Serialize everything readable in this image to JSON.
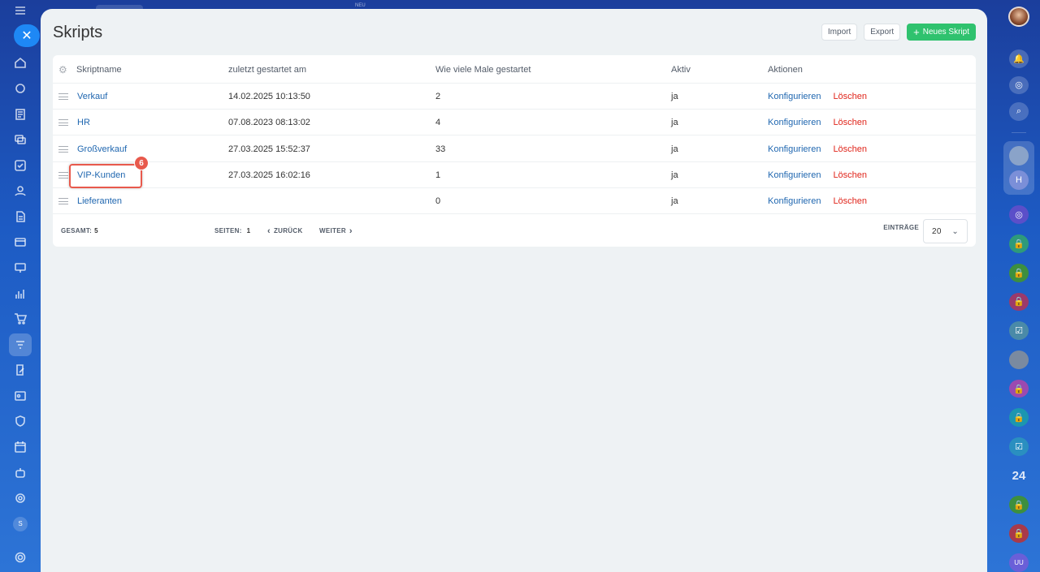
{
  "topbar": {
    "neu_label": "NEU"
  },
  "sidebar": {
    "user_initial": "S"
  },
  "right_rail": {
    "counter_label": "24",
    "chat_initial": "H",
    "bottom_initials": "UU"
  },
  "page": {
    "title": "Skripts"
  },
  "toolbar": {
    "import_label": "Import",
    "export_label": "Export",
    "new_label": "Neues Skript"
  },
  "table": {
    "columns": {
      "name": "Skriptname",
      "last_started": "zuletzt gestartet am",
      "times_started": "Wie viele Male gestartet",
      "active": "Aktiv",
      "actions": "Aktionen"
    },
    "rows": [
      {
        "name": "Verkauf",
        "last_started": "14.02.2025 10:13:50",
        "times": "2",
        "active": "ja",
        "configure": "Konfigurieren",
        "delete": "Löschen"
      },
      {
        "name": "HR",
        "last_started": "07.08.2023 08:13:02",
        "times": "4",
        "active": "ja",
        "configure": "Konfigurieren",
        "delete": "Löschen"
      },
      {
        "name": "Großverkauf",
        "last_started": "27.03.2025 15:52:37",
        "times": "33",
        "active": "ja",
        "configure": "Konfigurieren",
        "delete": "Löschen"
      },
      {
        "name": "VIP-Kunden",
        "last_started": "27.03.2025 16:02:16",
        "times": "1",
        "active": "ja",
        "configure": "Konfigurieren",
        "delete": "Löschen"
      },
      {
        "name": "Lieferanten",
        "last_started": "",
        "times": "0",
        "active": "ja",
        "configure": "Konfigurieren",
        "delete": "Löschen"
      }
    ]
  },
  "annotation": {
    "step_number": "6"
  },
  "footer": {
    "total_label": "Gesamt:",
    "total_value": "5",
    "pages_label": "Seiten:",
    "pages_value": "1",
    "prev_label": "Zurück",
    "next_label": "Weiter",
    "entries_label": "Einträge",
    "entries_value": "20"
  }
}
